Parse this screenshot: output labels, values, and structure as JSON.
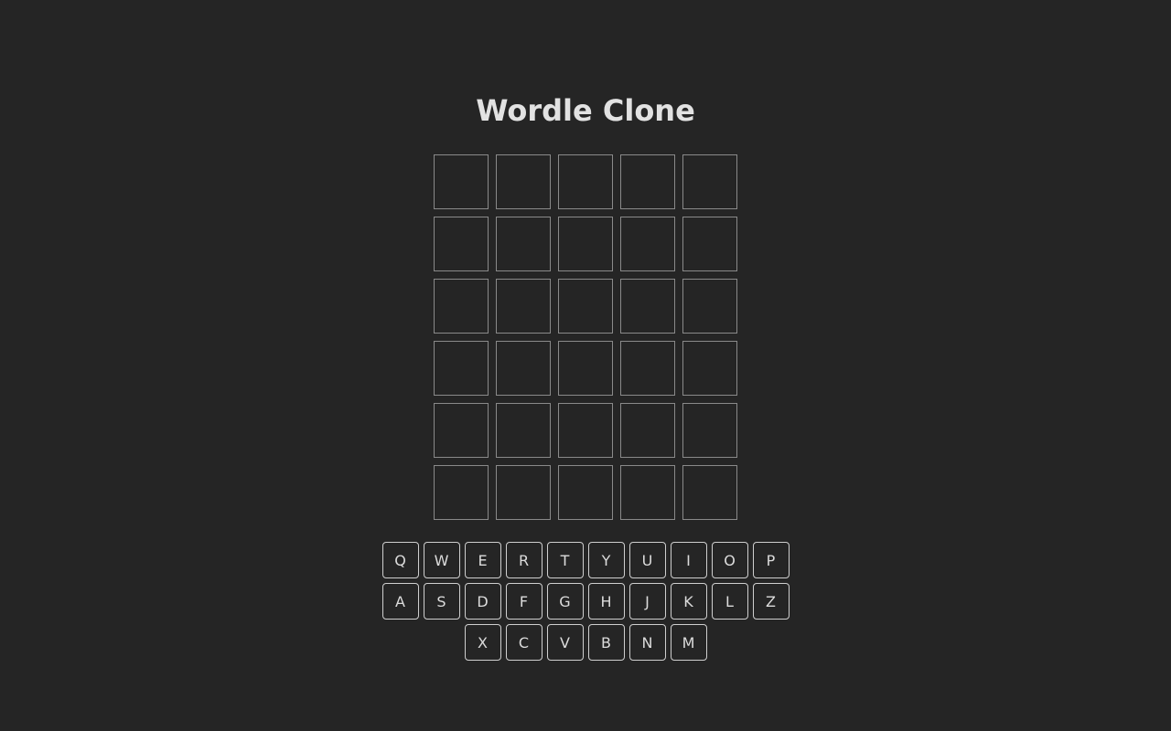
{
  "title": "Wordle Clone",
  "board": {
    "rows": 6,
    "cols": 5,
    "tiles": [
      [
        "",
        "",
        "",
        "",
        ""
      ],
      [
        "",
        "",
        "",
        "",
        ""
      ],
      [
        "",
        "",
        "",
        "",
        ""
      ],
      [
        "",
        "",
        "",
        "",
        ""
      ],
      [
        "",
        "",
        "",
        "",
        ""
      ],
      [
        "",
        "",
        "",
        "",
        ""
      ]
    ]
  },
  "keyboard": {
    "rows": [
      [
        "Q",
        "W",
        "E",
        "R",
        "T",
        "Y",
        "U",
        "I",
        "O",
        "P"
      ],
      [
        "A",
        "S",
        "D",
        "F",
        "G",
        "H",
        "J",
        "K",
        "L",
        "Z"
      ],
      [
        "X",
        "C",
        "V",
        "B",
        "N",
        "M"
      ]
    ]
  },
  "colors": {
    "background": "#252525",
    "tile_border": "#8a8a8a",
    "key_border": "#cfcfcf",
    "text": "#e2e2e2"
  }
}
